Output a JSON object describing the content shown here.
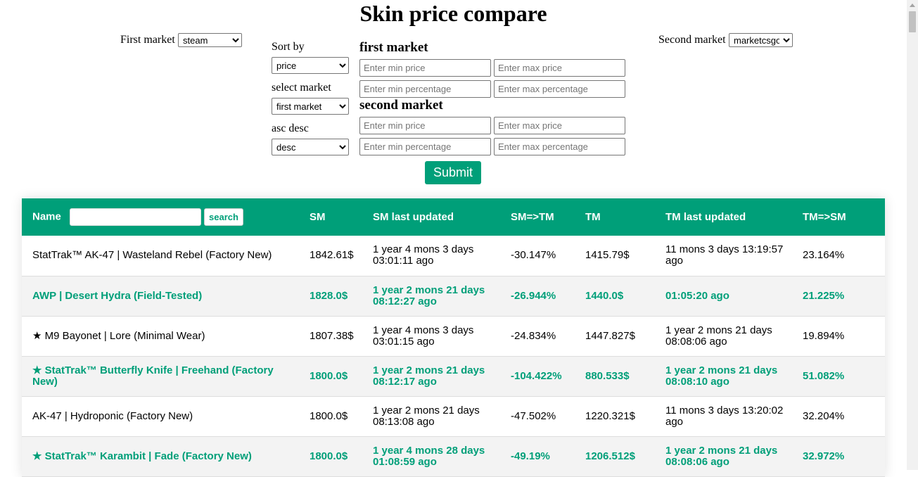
{
  "page_title": "Skin price compare",
  "first_market": {
    "label": "First market",
    "selected": "steam"
  },
  "second_market": {
    "label": "Second market",
    "selected": "marketcsgo"
  },
  "sort_by": {
    "label": "Sort by",
    "selected": "price"
  },
  "select_market": {
    "label": "select market",
    "selected": "first market"
  },
  "order": {
    "label": "asc desc",
    "selected": "desc"
  },
  "filters": {
    "first_heading": "first market",
    "second_heading": "second market",
    "min_price_placeholder": "Enter min price",
    "max_price_placeholder": "Enter max price",
    "min_pct_placeholder": "Enter min percentage",
    "max_pct_placeholder": "Enter max percentage"
  },
  "submit_label": "Submit",
  "accent_color": "#009f79",
  "table": {
    "headers": {
      "name": "Name",
      "search_button": "search",
      "sm": "SM",
      "sm_updated": "SM last updated",
      "sm_to_tm": "SM=>TM",
      "tm": "TM",
      "tm_updated": "TM last updated",
      "tm_to_sm": "TM=>SM"
    },
    "rows": [
      {
        "name": "StatTrak™ AK-47 | Wasteland Rebel (Factory New)",
        "sm": "1842.61$",
        "sm_updated": "1 year 4 mons 3 days 03:01:11 ago",
        "sm_to_tm": "-30.147%",
        "tm": "1415.79$",
        "tm_updated": "11 mons 3 days 13:19:57 ago",
        "tm_to_sm": "23.164%"
      },
      {
        "name": "AWP | Desert Hydra (Field-Tested)",
        "sm": "1828.0$",
        "sm_updated": "1 year 2 mons 21 days 08:12:27 ago",
        "sm_to_tm": "-26.944%",
        "tm": "1440.0$",
        "tm_updated": "01:05:20 ago",
        "tm_to_sm": "21.225%"
      },
      {
        "name": "★ M9 Bayonet | Lore (Minimal Wear)",
        "sm": "1807.38$",
        "sm_updated": "1 year 4 mons 3 days 03:01:15 ago",
        "sm_to_tm": "-24.834%",
        "tm": "1447.827$",
        "tm_updated": "1 year 2 mons 21 days 08:08:06 ago",
        "tm_to_sm": "19.894%"
      },
      {
        "name": "★ StatTrak™ Butterfly Knife | Freehand (Factory New)",
        "sm": "1800.0$",
        "sm_updated": "1 year 2 mons 21 days 08:12:17 ago",
        "sm_to_tm": "-104.422%",
        "tm": "880.533$",
        "tm_updated": "1 year 2 mons 21 days 08:08:10 ago",
        "tm_to_sm": "51.082%"
      },
      {
        "name": "AK-47 | Hydroponic (Factory New)",
        "sm": "1800.0$",
        "sm_updated": "1 year 2 mons 21 days 08:13:08 ago",
        "sm_to_tm": "-47.502%",
        "tm": "1220.321$",
        "tm_updated": "11 mons 3 days 13:20:02 ago",
        "tm_to_sm": "32.204%"
      },
      {
        "name": "★ StatTrak™ Karambit | Fade (Factory New)",
        "sm": "1800.0$",
        "sm_updated": "1 year 4 mons 28 days 01:08:59 ago",
        "sm_to_tm": "-49.19%",
        "tm": "1206.512$",
        "tm_updated": "1 year 2 mons 21 days 08:08:06 ago",
        "tm_to_sm": "32.972%"
      }
    ]
  }
}
